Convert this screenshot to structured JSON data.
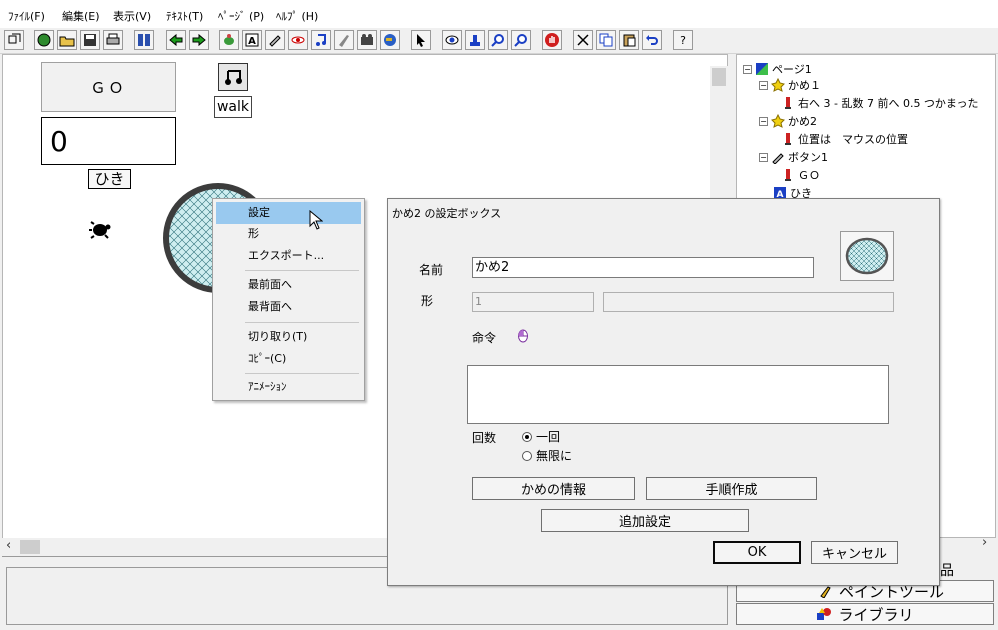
{
  "menu": {
    "file": "ﾌｧｲﾙ(F)",
    "edit": "編集(E)",
    "view": "表示(V)",
    "text": "ﾃｷｽﾄ(T)",
    "page": "ﾍﾟｰｼﾞ (P)",
    "help": "ﾍﾙﾌﾟ (H)"
  },
  "toolbar": {
    "help_glyph": "?"
  },
  "stage": {
    "go_button": "ＧＯ",
    "counter_value": "0",
    "hiki_label": "ひき",
    "walk_label": "walk"
  },
  "context_menu": {
    "items": [
      "設定",
      "形",
      "エクスポート...",
      "最前面へ",
      "最背面へ",
      "切り取り(T)",
      "ｺﾋﾟｰ(C)",
      "ｱﾆﾒｰｼｮﾝ"
    ]
  },
  "tree": {
    "page": "ページ1",
    "kame1": "かめ１",
    "kame1_cmd": "右へ 3 - 乱数 7 前へ 0.5 つかまった",
    "kame2": "かめ2",
    "kame2_cmd": "位置は　マウスの位置",
    "button1": "ボタン1",
    "button1_cmd": "ＧＯ",
    "hiki": "ひき"
  },
  "side_tabs": {
    "parts_fragment": "品",
    "paint_tool": "ペイントツール",
    "library": "ライブラリ"
  },
  "dialog": {
    "title": "かめ2 の設定ボックス",
    "name_label": "名前",
    "name_value": "かめ2",
    "shape_label": "形",
    "shape_value": "1",
    "command_label": "命令",
    "count_label": "回数",
    "radio_once": "一回",
    "radio_infinite": "無限に",
    "btn_info": "かめの情報",
    "btn_procedure": "手順作成",
    "btn_extra": "追加設定",
    "btn_ok": "OK",
    "btn_cancel": "キャンセル"
  }
}
